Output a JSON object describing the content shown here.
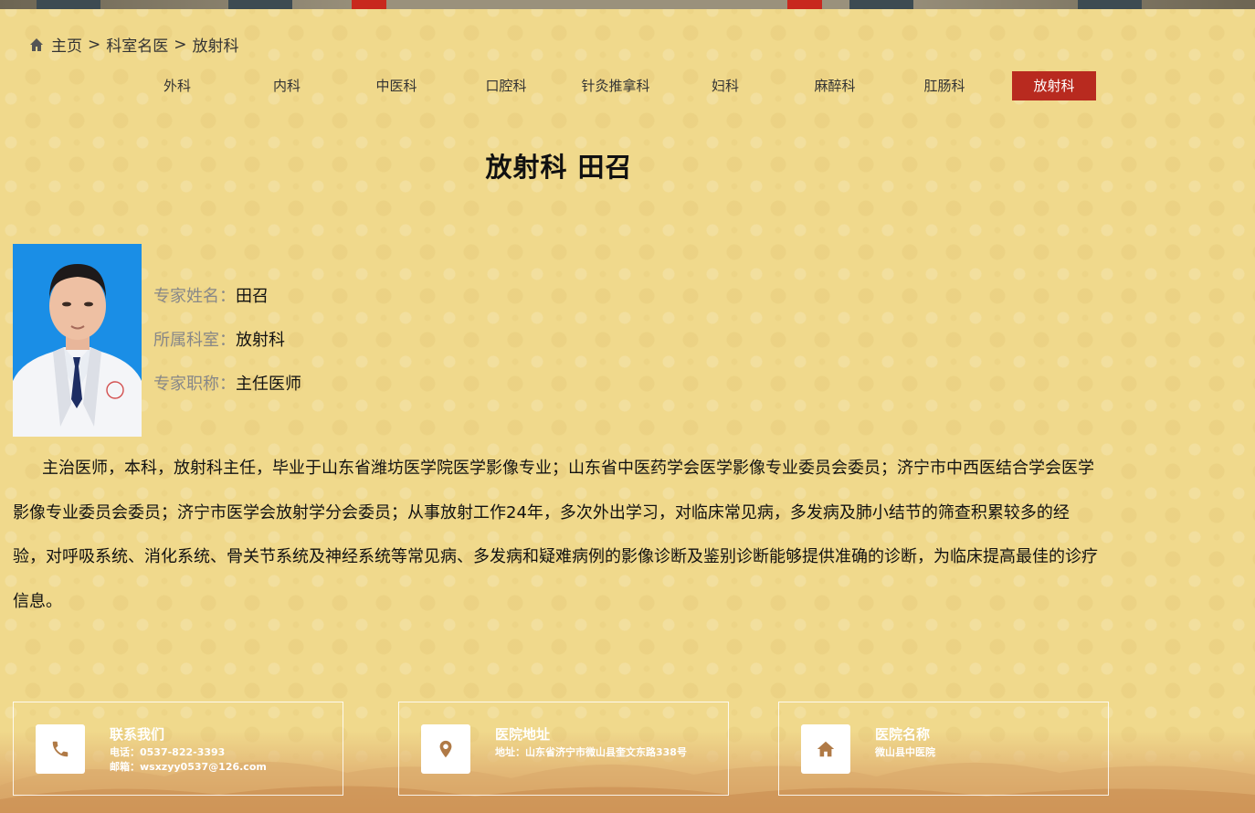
{
  "breadcrumb": {
    "home": "主页",
    "separator": ">",
    "level2": "科室名医",
    "current": "放射科"
  },
  "departments": [
    {
      "label": "外科",
      "active": false
    },
    {
      "label": "内科",
      "active": false
    },
    {
      "label": "中医科",
      "active": false
    },
    {
      "label": "口腔科",
      "active": false
    },
    {
      "label": "针灸推拿科",
      "active": false
    },
    {
      "label": "妇科",
      "active": false
    },
    {
      "label": "麻醉科",
      "active": false
    },
    {
      "label": "肛肠科",
      "active": false
    },
    {
      "label": "放射科",
      "active": true
    }
  ],
  "page_title": "放射科 田召",
  "doctor": {
    "name_label": "专家姓名：",
    "name": "田召",
    "dept_label": "所属科室：",
    "dept": "放射科",
    "title_label": "专家职称：",
    "title": "主任医师"
  },
  "bio": "主治医师，本科，放射科主任，毕业于山东省潍坊医学院医学影像专业；山东省中医药学会医学影像专业委员会委员；济宁市中西医结合学会医学影像专业委员会委员；济宁市医学会放射学分会委员；从事放射工作24年，多次外出学习，对临床常见病，多发病及肺小结节的筛查积累较多的经验，对呼吸系统、消化系统、骨关节系统及神经系统等常见病、多发病和疑难病例的影像诊断及鉴别诊断能够提供准确的诊断，为临床提高最佳的诊疗信息。",
  "footer": {
    "contact": {
      "title": "联系我们",
      "phone": "电话：0537-822-3393",
      "email": "邮箱：wsxzyy0537@126.com",
      "icon": "phone-icon"
    },
    "address": {
      "title": "医院地址",
      "line": "地址：山东省济宁市微山县奎文东路338号",
      "icon": "location-pin-icon"
    },
    "hospital": {
      "title": "医院名称",
      "line": "微山县中医院",
      "icon": "home-icon"
    }
  },
  "colors": {
    "background": "#f0d98c",
    "active_tab": "#b82a1f",
    "icon_brown": "#b07a46",
    "label_gray": "#888888"
  }
}
